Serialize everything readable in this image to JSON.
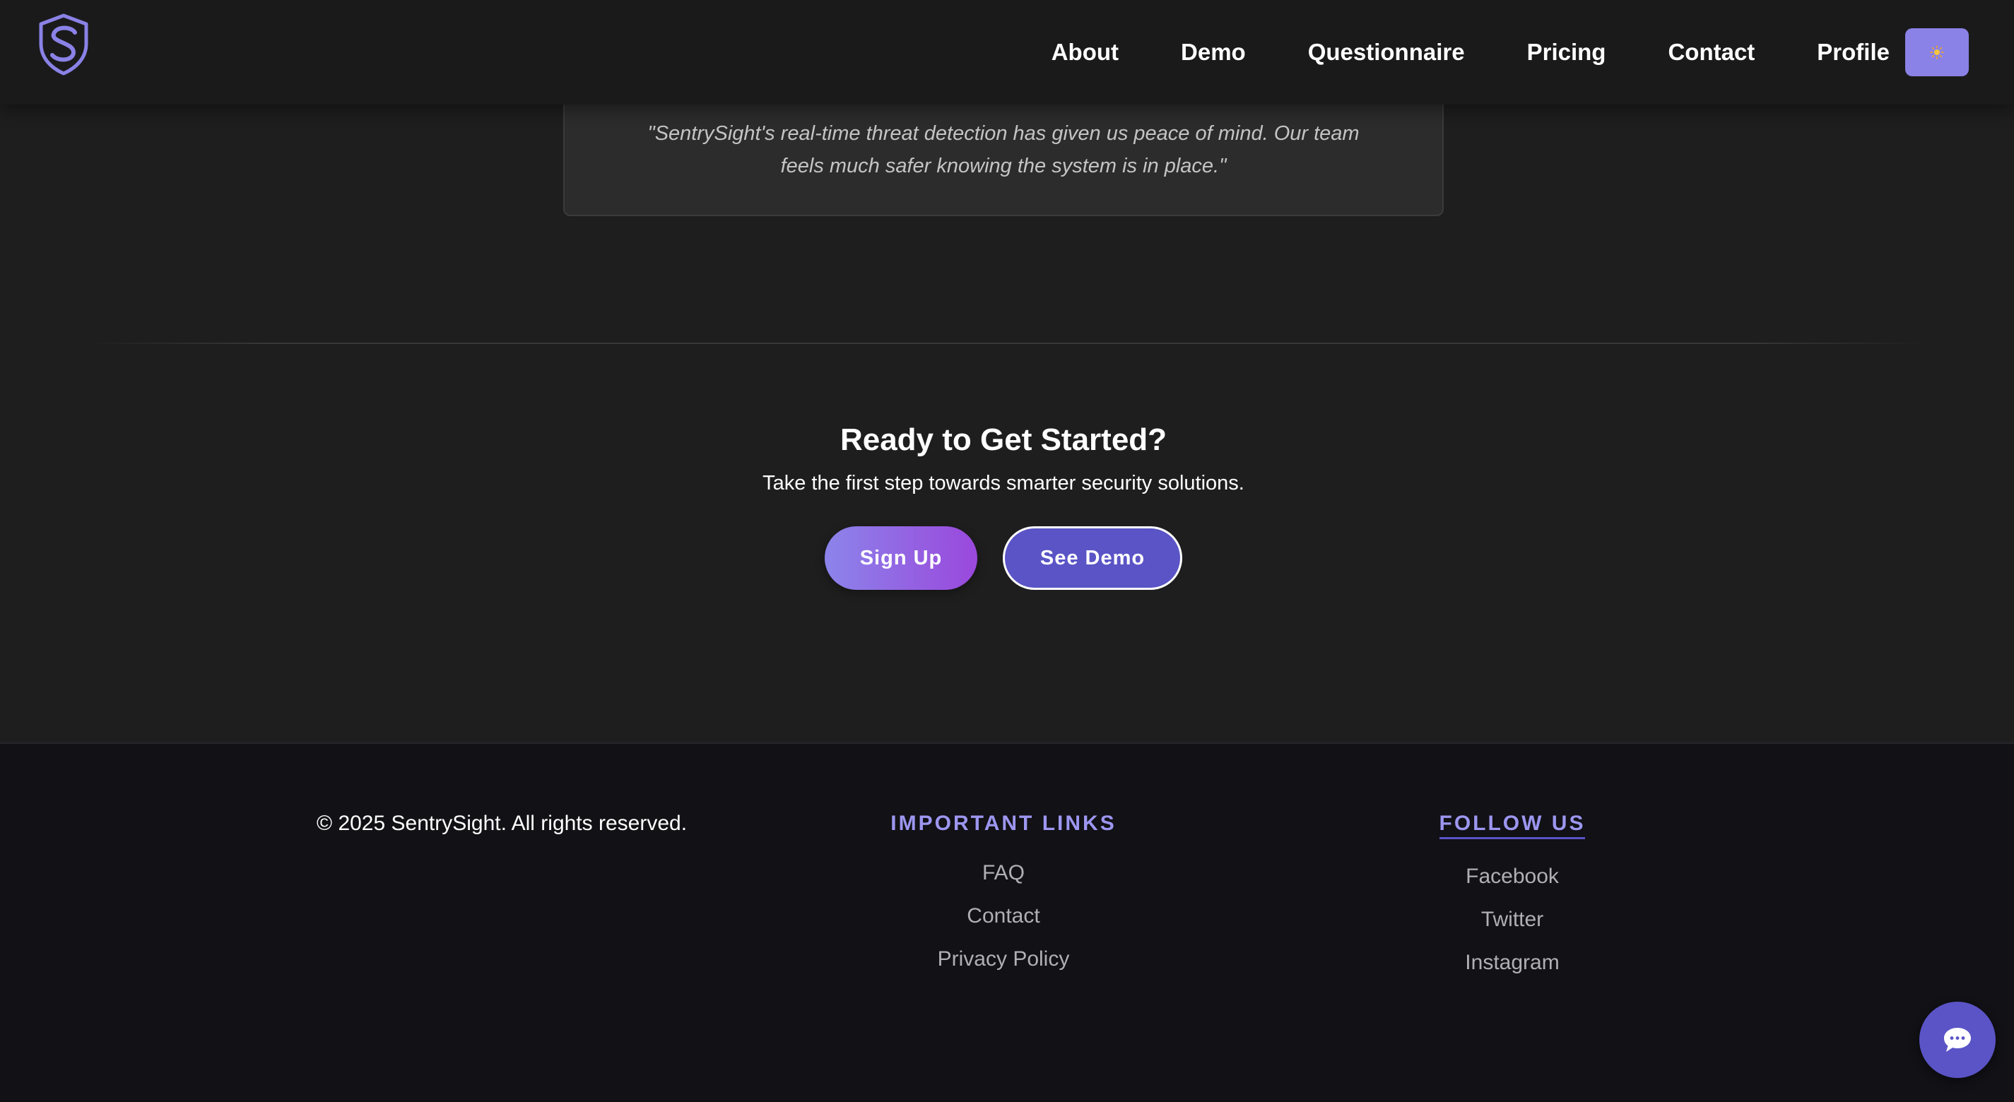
{
  "header": {
    "logo_icon": "shield-s-logo-icon",
    "nav": [
      {
        "label": "About"
      },
      {
        "label": "Demo"
      },
      {
        "label": "Questionnaire"
      },
      {
        "label": "Pricing"
      },
      {
        "label": "Contact"
      },
      {
        "label": "Profile"
      }
    ],
    "theme_toggle_icon": "sun-icon",
    "accent_color": "#8a82e6"
  },
  "testimonial": {
    "quote": "\"SentrySight's real-time threat detection has given us peace of mind. Our team feels much safer knowing the system is in place.\""
  },
  "cta": {
    "title": "Ready to Get Started?",
    "subtitle": "Take the first step towards smarter security solutions.",
    "signup_label": "Sign Up",
    "demo_label": "See Demo"
  },
  "footer": {
    "copyright": "© 2025 SentrySight. All rights reserved.",
    "links_heading": "IMPORTANT LINKS",
    "links": [
      {
        "label": "FAQ"
      },
      {
        "label": "Contact"
      },
      {
        "label": "Privacy Policy"
      }
    ],
    "follow_heading": "FOLLOW US",
    "social": [
      {
        "label": "Facebook"
      },
      {
        "label": "Twitter"
      },
      {
        "label": "Instagram"
      }
    ],
    "heading_color": "#9d96f0"
  },
  "chat": {
    "icon": "chat-bubble-icon"
  }
}
